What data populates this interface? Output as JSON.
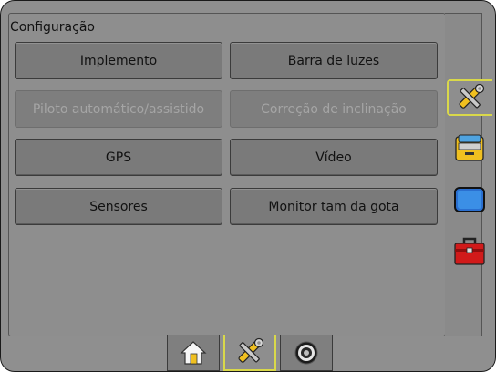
{
  "screen": {
    "title": "Configuração"
  },
  "buttons": [
    {
      "label": "Implemento",
      "enabled": true
    },
    {
      "label": "Barra de luzes",
      "enabled": true
    },
    {
      "label": "Piloto automático/assistido",
      "enabled": false
    },
    {
      "label": "Correção de inclinação",
      "enabled": false
    },
    {
      "label": "GPS",
      "enabled": true
    },
    {
      "label": "Vídeo",
      "enabled": true
    },
    {
      "label": "Sensores",
      "enabled": true
    },
    {
      "label": "Monitor tam da gota",
      "enabled": true
    }
  ],
  "side_tabs": [
    {
      "icon": "tools-icon",
      "active": true
    },
    {
      "icon": "console-icon",
      "active": false
    },
    {
      "icon": "display-icon",
      "active": false
    },
    {
      "icon": "toolbox-icon",
      "active": false
    }
  ],
  "bottom_tabs": [
    {
      "icon": "home-icon",
      "active": false
    },
    {
      "icon": "tools-icon",
      "active": true
    },
    {
      "icon": "gauge-icon",
      "active": false
    }
  ],
  "colors": {
    "active_outline": "#d9d84a",
    "background": "#8f8f8f",
    "button": "#7a7a7a",
    "disabled_text": "#a5a5a5"
  }
}
